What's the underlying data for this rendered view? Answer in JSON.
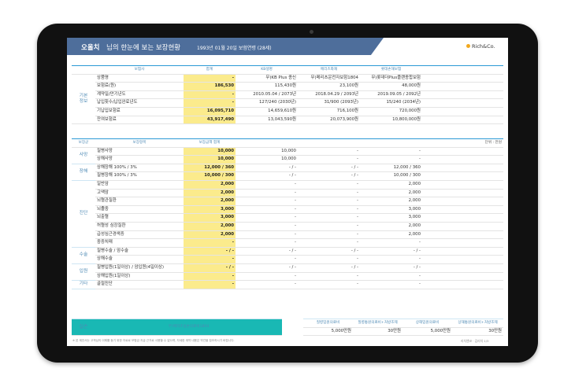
{
  "header": {
    "name": "오올치",
    "title": "님의 한눈에 보는 보장현황",
    "date": "1993년 01월 20일 보험연령 (28세)",
    "logo": "Rich&Co."
  },
  "basic": {
    "section_label": "기본\n정보",
    "columns": [
      "보험사",
      "합계",
      "KB생명",
      "메리츠화재",
      "롯데손해보험"
    ],
    "rows": [
      {
        "label": "상품명",
        "total": "-",
        "c1": "무)KB Plus 종신",
        "c2": "무)메리츠운전자보험1804",
        "c3": "무)롯데더Plus플랜종합보험"
      },
      {
        "label": "보험료(원)",
        "total": "186,530",
        "c1": "115,430원",
        "c2": "23,100원",
        "c3": "48,000원"
      },
      {
        "label": "계약일/만기년도",
        "total": "-",
        "c1": "2010.05.04 / 2073년",
        "c2": "2018.04.29 / 2093년",
        "c3": "2019.09.05 / 2092년"
      },
      {
        "label": "납입횟수/납입완료년도",
        "total": "-",
        "c1": "127/240 (2030년)",
        "c2": "31/900 (2093년)",
        "c3": "15/240 (2034년)"
      },
      {
        "label": "기납입보험료",
        "total": "16,095,710",
        "c1": "14,659,610원",
        "c2": "716,100원",
        "c3": "720,000원"
      },
      {
        "label": "잔여보험료",
        "total": "43,917,490",
        "c1": "13,043,590원",
        "c2": "20,073,900원",
        "c3": "10,800,000원"
      }
    ]
  },
  "coverage": {
    "columns": [
      "보장군",
      "보장항목",
      "보장금액 합계"
    ],
    "unit": "단위 : 만원",
    "groups": [
      {
        "name": "사망",
        "rows": [
          {
            "label": "질병사망",
            "total": "10,000",
            "c1": "10,000",
            "c2": "-",
            "c3": "-"
          },
          {
            "label": "상해사망",
            "total": "10,000",
            "c1": "10,000",
            "c2": "-",
            "c3": "-"
          }
        ]
      },
      {
        "name": "장해",
        "rows": [
          {
            "label": "상해장해 100% / 3%",
            "total": "12,000 / 360",
            "c1": "- / -",
            "c2": "- / -",
            "c3": "12,000 / 360"
          },
          {
            "label": "질병장해 100% / 3%",
            "total": "10,000 / 300",
            "c1": "- / -",
            "c2": "- / -",
            "c3": "10,000 / 300"
          }
        ]
      },
      {
        "name": "진단",
        "rows": [
          {
            "label": "일반암",
            "total": "2,000",
            "c1": "-",
            "c2": "-",
            "c3": "2,000"
          },
          {
            "label": "고액암",
            "total": "2,000",
            "c1": "-",
            "c2": "-",
            "c3": "2,000"
          },
          {
            "label": "뇌혈관질환",
            "total": "2,000",
            "c1": "-",
            "c2": "-",
            "c3": "2,000"
          },
          {
            "label": "뇌졸중",
            "total": "3,000",
            "c1": "-",
            "c2": "-",
            "c3": "3,000"
          },
          {
            "label": "뇌출혈",
            "total": "3,000",
            "c1": "-",
            "c2": "-",
            "c3": "3,000"
          },
          {
            "label": "허혈성 심장질환",
            "total": "2,000",
            "c1": "-",
            "c2": "-",
            "c3": "2,000"
          },
          {
            "label": "급성심근경색증",
            "total": "2,000",
            "c1": "-",
            "c2": "-",
            "c3": "2,000"
          },
          {
            "label": "중증치매",
            "total": "-",
            "c1": "-",
            "c2": "-",
            "c3": "-"
          }
        ]
      },
      {
        "name": "수술",
        "rows": [
          {
            "label": "질병수술 / 암수술",
            "total": "- / -",
            "c1": "- / -",
            "c2": "- / -",
            "c3": "- / -"
          },
          {
            "label": "상해수술",
            "total": "-",
            "c1": "-",
            "c2": "-",
            "c3": "-"
          }
        ]
      },
      {
        "name": "입원",
        "rows": [
          {
            "label": "질병입원(1일이상) / 암입원(4일이상)",
            "total": "- / -",
            "c1": "- / -",
            "c2": "- / -",
            "c3": "- / -"
          },
          {
            "label": "상해입원(1일이상)",
            "total": "-",
            "c1": "-",
            "c2": "-",
            "c3": "-"
          }
        ]
      },
      {
        "name": "기타",
        "rows": [
          {
            "label": "골절진단",
            "total": "-",
            "c1": "-",
            "c2": "-",
            "c3": "-"
          }
        ]
      }
    ]
  },
  "silson": {
    "label": "실손",
    "product": "무)메리츠실손의료비1804",
    "headers": [
      "질병입원의료비",
      "질병통원의료비+처방조제",
      "상해입원의료비",
      "상해통원의료비+처방조제"
    ],
    "values": [
      "5,000만원",
      "30만원",
      "5,000만원",
      "30만원"
    ]
  },
  "footer": {
    "note": "※ 본 제안서는 고객님의 이해를 돕기 위한 자료로 보험금 지급 근거로 사용할 수 없으며, 자세한 계약 내용은 약관을 참조하시기 바랍니다.",
    "page": "리치앤코 · 김리치   1/3"
  }
}
